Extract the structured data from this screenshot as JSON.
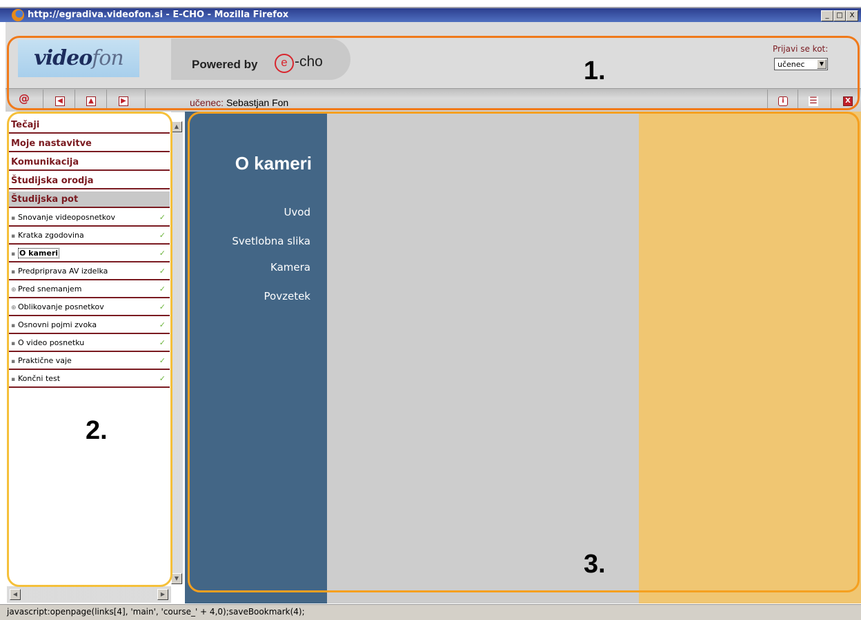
{
  "window": {
    "title": "http://egradiva.videofon.si - E-CHO - Mozilla Firefox",
    "controls": [
      "_",
      "□",
      "X"
    ]
  },
  "header": {
    "logo_main": "video",
    "logo_tail": "fon",
    "powered_by": "Powered by",
    "brand_mark": "e",
    "brand_rest": "-cho",
    "login_label": "Prijavi se kot:",
    "role_value": "učenec"
  },
  "toolbar": {
    "user_role_label": "učenec:",
    "user_name": "Sebastjan Fon",
    "buttons": [
      "echo-home",
      "back",
      "up",
      "forward",
      "info",
      "notes",
      "close"
    ]
  },
  "sidebar": {
    "sections": [
      {
        "label": "Tečaji"
      },
      {
        "label": "Moje nastavitve"
      },
      {
        "label": "Komunikacija"
      },
      {
        "label": "Študijska orodja"
      },
      {
        "label": "Študijska pot"
      }
    ],
    "items": [
      {
        "label": "Snovanje videoposnetkov",
        "bullet": "▪",
        "done": "✓"
      },
      {
        "label": "Kratka zgodovina",
        "bullet": "▪",
        "done": "✓"
      },
      {
        "label": "O kameri",
        "bullet": "▪",
        "done": "✓"
      },
      {
        "label": "Predpriprava AV izdelka",
        "bullet": "▪",
        "done": "✓"
      },
      {
        "label": "Pred snemanjem",
        "bullet": "⊕",
        "done": "✓"
      },
      {
        "label": "Oblikovanje posnetkov",
        "bullet": "⊕",
        "done": "✓"
      },
      {
        "label": "Osnovni pojmi zvoka",
        "bullet": "▪",
        "done": "✓"
      },
      {
        "label": "O video posnetku",
        "bullet": "▪",
        "done": "✓"
      },
      {
        "label": "Praktične vaje",
        "bullet": "▪",
        "done": "✓"
      },
      {
        "label": "Končni test",
        "bullet": "▪",
        "done": "✓"
      }
    ]
  },
  "main": {
    "topic_title": "O kameri",
    "links": [
      "Uvod",
      "Svetlobna slika",
      "Kamera",
      "Povzetek"
    ]
  },
  "statusbar": {
    "text": "javascript:openpage(links[4], 'main', 'course_' + 4,0);saveBookmark(4);"
  },
  "annotations": {
    "region_1": "1.",
    "region_2": "2.",
    "region_3": "3."
  },
  "colors": {
    "accent_maroon": "#7a1a20",
    "main_blue": "#436686",
    "main_gray": "#cdcdcd",
    "main_orange": "#f0c672",
    "region_1_border": "#f07a1a",
    "region_2_border": "#f5c03a",
    "region_3_border": "#f5a020",
    "check_green": "#6bb43a"
  }
}
